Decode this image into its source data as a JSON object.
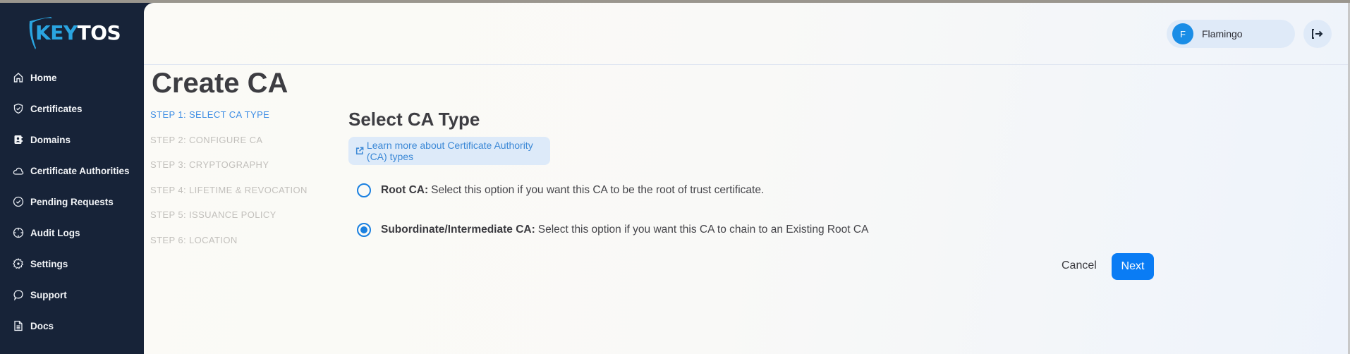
{
  "brand": {
    "name_part1": "KEY",
    "name_part2": "TOS",
    "accent": "#2aa4e0"
  },
  "sidebar": {
    "items": [
      {
        "label": "Home",
        "icon": "home-icon"
      },
      {
        "label": "Certificates",
        "icon": "shield-check-icon"
      },
      {
        "label": "Domains",
        "icon": "contact-book-icon"
      },
      {
        "label": "Certificate Authorities",
        "icon": "cloud-icon"
      },
      {
        "label": "Pending Requests",
        "icon": "check-circle-icon"
      },
      {
        "label": "Audit Logs",
        "icon": "crosshair-icon"
      },
      {
        "label": "Settings",
        "icon": "gear-icon"
      },
      {
        "label": "Support",
        "icon": "chat-bubble-icon"
      },
      {
        "label": "Docs",
        "icon": "document-icon"
      }
    ]
  },
  "header": {
    "user": {
      "initial": "F",
      "name": "Flamingo"
    },
    "logout_icon": "logout-icon"
  },
  "page": {
    "title": "Create CA",
    "steps": [
      {
        "label": "STEP 1: SELECT CA TYPE",
        "active": true
      },
      {
        "label": "STEP 2: CONFIGURE CA",
        "active": false
      },
      {
        "label": "STEP 3: CRYPTOGRAPHY",
        "active": false
      },
      {
        "label": "STEP 4: LIFETIME & REVOCATION",
        "active": false
      },
      {
        "label": "STEP 5: ISSUANCE POLICY",
        "active": false
      },
      {
        "label": "STEP 6: LOCATION",
        "active": false
      }
    ],
    "section_title": "Select CA Type",
    "learn_more": "Learn more about Certificate Authority (CA) types",
    "options": [
      {
        "title": "Root CA:",
        "description": "Select this option if you want this CA to be the root of trust certificate.",
        "selected": false
      },
      {
        "title": "Subordinate/Intermediate CA:",
        "description": "Select this option if you want this CA to chain to an Existing Root CA",
        "selected": true
      }
    ],
    "cancel_label": "Cancel",
    "next_label": "Next"
  }
}
